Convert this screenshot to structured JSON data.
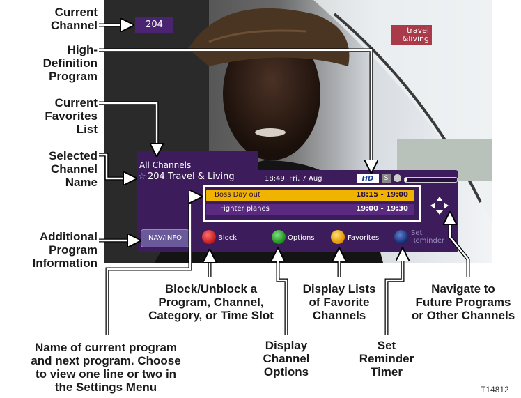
{
  "callouts": {
    "current_channel": [
      "Current",
      "Channel"
    ],
    "hd_program": [
      "High-",
      "Definition",
      "Program"
    ],
    "favorites_list": [
      "Current",
      "Favorites",
      "List"
    ],
    "selected_channel_name": [
      "Selected",
      "Channel",
      "Name"
    ],
    "additional_info": [
      "Additional",
      "Program",
      "Information"
    ],
    "block": [
      "Block/Unblock a",
      "Program, Channel,",
      "Category, or Time Slot"
    ],
    "display_lists": [
      "Display Lists",
      "of Favorite",
      "Channels"
    ],
    "navigate": [
      "Navigate to",
      "Future Programs",
      "or Other Channels"
    ],
    "program_name": [
      "Name of current program",
      "and next program. Choose",
      "to view one line or two in",
      "the Settings Menu"
    ],
    "channel_options": [
      "Display",
      "Channel",
      "Options"
    ],
    "reminder": [
      "Set",
      "Reminder",
      "Timer"
    ]
  },
  "screen": {
    "channel_number": "204",
    "brand_logo_line1": "travel",
    "brand_logo_line2": "&living",
    "list_name": "All Channels",
    "channel_name": "204 Travel & Living",
    "datetime": "18:49, Fri, 7 Aug",
    "hd_badge": "HD",
    "s_badge": "S",
    "current_program": {
      "title": "Boss Day out",
      "time": "18:15 - 19:00"
    },
    "next_program": {
      "title": "Fighter planes",
      "time": "19:00 - 19:30"
    },
    "nav_info_label": "NAV/INFO",
    "buttons": {
      "red": "Block",
      "green": "Options",
      "yellow": "Favorites",
      "blue_line1": "Set",
      "blue_line2": "Reminder"
    }
  },
  "figure_id": "T14812",
  "colors": {
    "panel_purple": "#3c1c5a",
    "highlight_yellow": "#f0b400",
    "red_button": "#d02020",
    "green_button": "#2a9a2a",
    "yellow_button": "#f0a000",
    "blue_button": "#1a3a8a"
  }
}
